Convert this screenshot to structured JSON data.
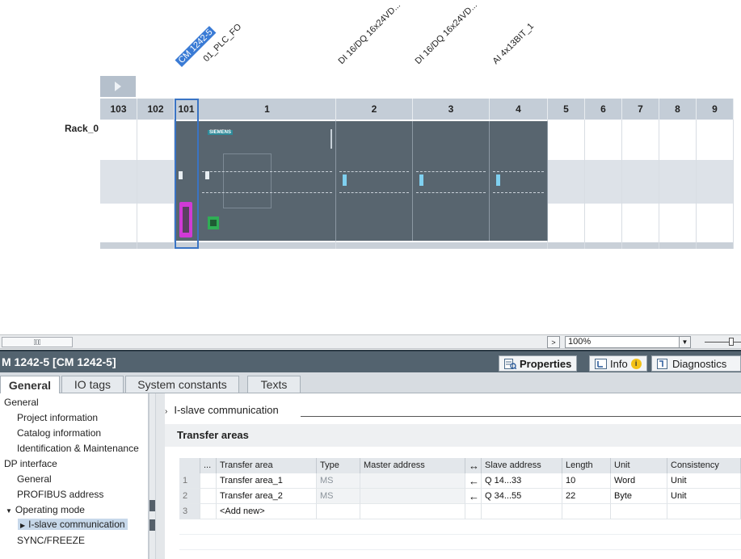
{
  "device_view": {
    "module_labels": [
      {
        "text": "CM 1242-5",
        "selected": true
      },
      {
        "text": "01_PLC_FO",
        "selected": false
      },
      {
        "text": "DI 16/DQ 16x24VD...",
        "selected": false
      },
      {
        "text": "DI 16/DQ 16x24VD...",
        "selected": false
      },
      {
        "text": "AI 4x13BIT_1",
        "selected": false
      }
    ],
    "rack_name": "Rack_0",
    "slots": [
      "103",
      "102",
      "101",
      "1",
      "2",
      "3",
      "4",
      "5",
      "6",
      "7",
      "8",
      "9"
    ],
    "colors": {
      "module": "#58656f",
      "rack_header": "#c4cdd7",
      "selection": "#3a7bd5",
      "dp_connector": "#d03ad6",
      "ethernet_port": "#2fae55"
    }
  },
  "statusbar": {
    "zoom_value": "100%",
    "nav_arrow": ">",
    "dropdown_arrow": "▼"
  },
  "inspector": {
    "title": "M 1242-5 [CM 1242-5]",
    "tabs": {
      "properties": "Properties",
      "info": "Info",
      "info_badge": "i",
      "diagnostics": "Diagnostics"
    }
  },
  "property_tabs": [
    "General",
    "IO tags",
    "System constants",
    "Texts"
  ],
  "nav_tree": [
    {
      "label": "General",
      "level": 0
    },
    {
      "label": "Project information",
      "level": 1
    },
    {
      "label": "Catalog information",
      "level": 1
    },
    {
      "label": "Identification & Maintenance",
      "level": 1
    },
    {
      "label": "DP interface",
      "level": 0
    },
    {
      "label": "General",
      "level": 1
    },
    {
      "label": "PROFIBUS address",
      "level": 1
    },
    {
      "label": "Operating mode",
      "level": 1,
      "expanded": true
    },
    {
      "label": "I-slave communication",
      "level": 2,
      "selected": true
    },
    {
      "label": "SYNC/FREEZE",
      "level": 1
    }
  ],
  "content": {
    "section_title": "I-slave communication",
    "subsection_title": "Transfer areas",
    "grid": {
      "headers": [
        "",
        "...",
        "Transfer area",
        "Type",
        "Master address",
        "↔",
        "Slave address",
        "Length",
        "Unit",
        "Consistency"
      ],
      "rows": [
        [
          "1",
          "",
          "Transfer area_1",
          "MS",
          "",
          "←",
          "Q 14...33",
          "10",
          "Word",
          "Unit"
        ],
        [
          "2",
          "",
          "Transfer area_2",
          "MS",
          "",
          "←",
          "Q 34...55",
          "22",
          "Byte",
          "Unit"
        ],
        [
          "3",
          "",
          "<Add new>",
          "",
          "",
          "",
          "",
          "",
          "",
          ""
        ]
      ]
    }
  }
}
